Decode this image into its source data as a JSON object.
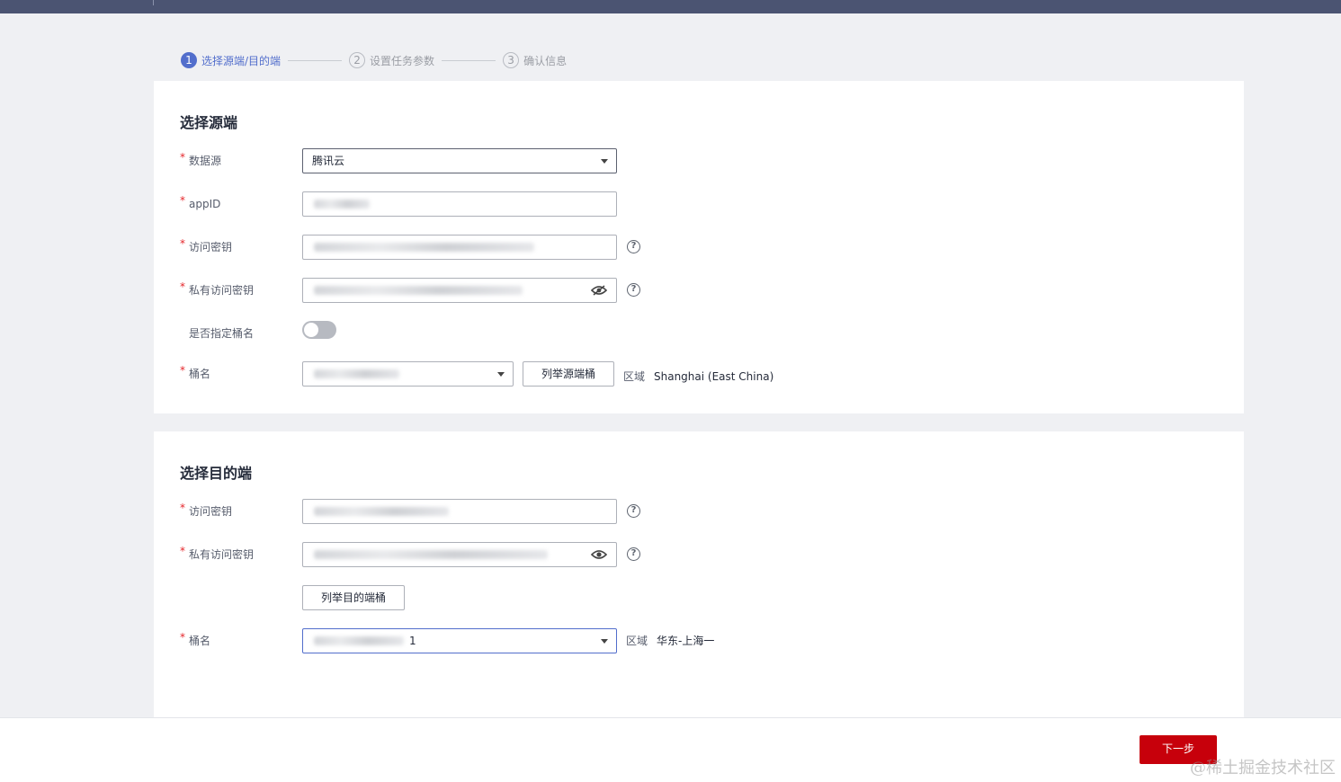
{
  "steps": [
    {
      "num": "1",
      "label": "选择源端/目的端"
    },
    {
      "num": "2",
      "label": "设置任务参数"
    },
    {
      "num": "3",
      "label": "确认信息"
    }
  ],
  "source": {
    "title": "选择源端",
    "datasource": {
      "label": "数据源",
      "value": "腾讯云"
    },
    "appid": {
      "label": "appID"
    },
    "access_key": {
      "label": "访问密钥"
    },
    "secret_key": {
      "label": "私有访问密钥"
    },
    "specify_bucket": {
      "label": "是否指定桶名",
      "enabled": false
    },
    "bucket": {
      "label": "桶名",
      "value": "1"
    },
    "list_button": "列举源端桶",
    "region_label": "区域",
    "region_value": "Shanghai (East China)"
  },
  "destination": {
    "title": "选择目的端",
    "access_key": {
      "label": "访问密钥"
    },
    "secret_key": {
      "label": "私有访问密钥"
    },
    "list_button": "列举目的端桶",
    "bucket": {
      "label": "桶名",
      "value": "1"
    },
    "region_label": "区域",
    "region_value": "华东-上海一"
  },
  "footer": {
    "next_label": "下一步"
  },
  "watermark": "@稀土掘金技术社区",
  "colors": {
    "accent": "#526ecc",
    "primary_button": "#c7000b",
    "topbar": "#4b5472"
  }
}
